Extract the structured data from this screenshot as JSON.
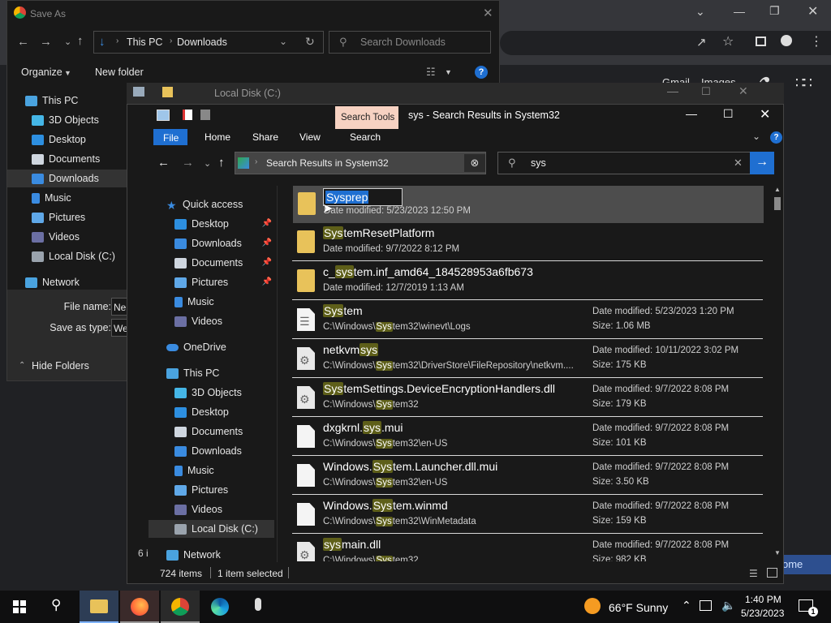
{
  "chrome": {
    "gmail": "Gmail",
    "images": "Images",
    "home_button": "ome"
  },
  "saveas": {
    "title": "Save As",
    "crumbs": [
      "This PC",
      "Downloads"
    ],
    "search_placeholder": "Search Downloads",
    "organize": "Organize",
    "new_folder": "New folder",
    "nav": [
      "This PC",
      "3D Objects",
      "Desktop",
      "Documents",
      "Downloads",
      "Music",
      "Pictures",
      "Videos",
      "Local Disk (C:)",
      "Network"
    ],
    "file_name_label": "File name:",
    "file_name_value": "Ne",
    "save_as_type_label": "Save as type:",
    "save_as_type_value": "We",
    "hide_folders": "Hide Folders",
    "status_partial": "6 i"
  },
  "explorer": {
    "ghost_title": "Local Disk (C:)",
    "search_tools": "Search Tools",
    "title": "sys - Search Results in System32",
    "tabs": [
      "File",
      "Home",
      "Share",
      "View",
      "Search"
    ],
    "address": "Search Results in System32",
    "search_value": "sys",
    "nav": {
      "quick_access": "Quick access",
      "quick_items": [
        "Desktop",
        "Downloads",
        "Documents",
        "Pictures",
        "Music",
        "Videos"
      ],
      "onedrive": "OneDrive",
      "this_pc": "This PC",
      "pc_items": [
        "3D Objects",
        "Desktop",
        "Documents",
        "Downloads",
        "Music",
        "Pictures",
        "Videos",
        "Local Disk (C:)"
      ],
      "network": "Network"
    },
    "rename_pre": "Sys",
    "rename_post": "prep",
    "results": [
      {
        "pre": "",
        "hl": "",
        "post": "",
        "sub_a": "Date modified: 5/23/2023 12:50 PM",
        "sub_hl": "",
        "sub_b": "",
        "dm": "",
        "sz": "",
        "icon": "folder"
      },
      {
        "pre": "",
        "hl": "Sys",
        "post": "temResetPlatform",
        "sub_a": "Date modified: 9/7/2022 8:12 PM",
        "sub_hl": "",
        "sub_b": "",
        "dm": "",
        "sz": "",
        "icon": "folder"
      },
      {
        "pre": "c_",
        "hl": "sys",
        "post": "tem.inf_amd64_184528953a6fb673",
        "sub_a": "Date modified: 12/7/2019 1:13 AM",
        "sub_hl": "",
        "sub_b": "",
        "dm": "",
        "sz": "",
        "icon": "folder"
      },
      {
        "pre": "",
        "hl": "Sys",
        "post": "tem",
        "sub_a": "C:\\Windows\\",
        "sub_hl": "Sys",
        "sub_b": "tem32\\winevt\\Logs",
        "dm": "Date modified: 5/23/2023 1:20 PM",
        "sz": "Size: 1.06 MB",
        "icon": "evt"
      },
      {
        "pre": "netkvm",
        "hl": "sys",
        "post": "",
        "sub_a": "C:\\Windows\\",
        "sub_hl": "Sys",
        "sub_b": "tem32\\DriverStore\\FileRepository\\netkvm....",
        "dm": "Date modified: 10/11/2022 3:02 PM",
        "sz": "Size: 175 KB",
        "icon": "gear"
      },
      {
        "pre": "",
        "hl": "Sys",
        "post": "temSettings.DeviceEncryptionHandlers.dll",
        "sub_a": "C:\\Windows\\",
        "sub_hl": "Sys",
        "sub_b": "tem32",
        "dm": "Date modified: 9/7/2022 8:08 PM",
        "sz": "Size: 179 KB",
        "icon": "gear"
      },
      {
        "pre": "dxgkrnl.",
        "hl": "sys",
        "post": ".mui",
        "sub_a": "C:\\Windows\\",
        "sub_hl": "Sys",
        "sub_b": "tem32\\en-US",
        "dm": "Date modified: 9/7/2022 8:08 PM",
        "sz": "Size: 101 KB",
        "icon": "doc"
      },
      {
        "pre": "Windows.",
        "hl": "Sys",
        "post": "tem.Launcher.dll.mui",
        "sub_a": "C:\\Windows\\",
        "sub_hl": "Sys",
        "sub_b": "tem32\\en-US",
        "dm": "Date modified: 9/7/2022 8:08 PM",
        "sz": "Size: 3.50 KB",
        "icon": "doc"
      },
      {
        "pre": "Windows.",
        "hl": "Sys",
        "post": "tem.winmd",
        "sub_a": "C:\\Windows\\",
        "sub_hl": "Sys",
        "sub_b": "tem32\\WinMetadata",
        "dm": "Date modified: 9/7/2022 8:08 PM",
        "sz": "Size: 159 KB",
        "icon": "doc"
      },
      {
        "pre": "",
        "hl": "sys",
        "post": "main.dll",
        "sub_a": "C:\\Windows\\",
        "sub_hl": "Sys",
        "sub_b": "tem32",
        "dm": "Date modified: 9/7/2022 8:08 PM",
        "sz": "Size: 982 KB",
        "icon": "gear"
      }
    ],
    "status_items": "724 items",
    "status_selected": "1 item selected"
  },
  "taskbar": {
    "weather": "66°F  Sunny",
    "time": "1:40 PM",
    "date": "5/23/2023",
    "notif_count": "1"
  }
}
